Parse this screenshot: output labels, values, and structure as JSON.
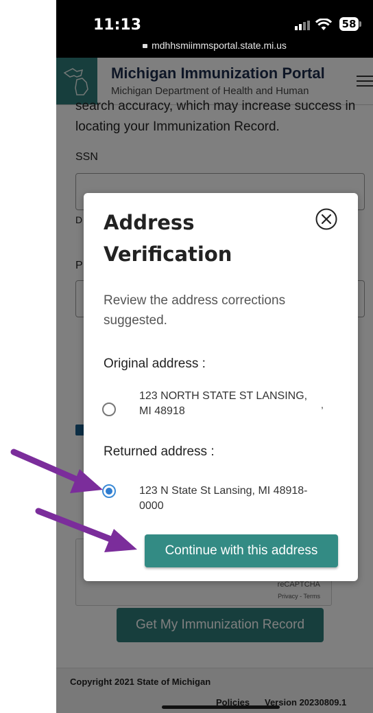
{
  "status_bar": {
    "time": "11:13",
    "url": "mdhhsmiimmsportal.state.mi.us",
    "battery": "58"
  },
  "header": {
    "title": "Michigan Immunization Portal",
    "subtitle": "Michigan Department of Health and Human"
  },
  "page": {
    "intro_text": "search accuracy, which may increase success in locating your Immunization Record.",
    "ssn_label": "SSN",
    "partial_label_d": "D",
    "partial_label_p": "P",
    "captcha_brand": "reCAPTCHA",
    "captcha_links": "Privacy - Terms",
    "submit_label": "Get My Immunization Record"
  },
  "footer": {
    "copyright": "Copyright 2021 State of Michigan",
    "policies": "Policies",
    "version": "Version 20230809.1"
  },
  "modal": {
    "title": "Address Verification",
    "description": "Review the address corrections suggested.",
    "original_label": "Original address :",
    "original_address": "123 NORTH STATE ST LANSING, MI 48918",
    "original_selected": false,
    "returned_label": "Returned address :",
    "returned_address": "123 N State St Lansing, MI 48918-0000",
    "returned_selected": true,
    "stray_mark": ",",
    "continue_label": "Continue with this address"
  },
  "annotations": {
    "arrow_color": "#7b2d9b"
  },
  "colors": {
    "brand_teal": "#2f7d7a",
    "button_teal": "#338b84",
    "radio_blue": "#2f7dd0",
    "header_navy": "#1c2c4c"
  }
}
